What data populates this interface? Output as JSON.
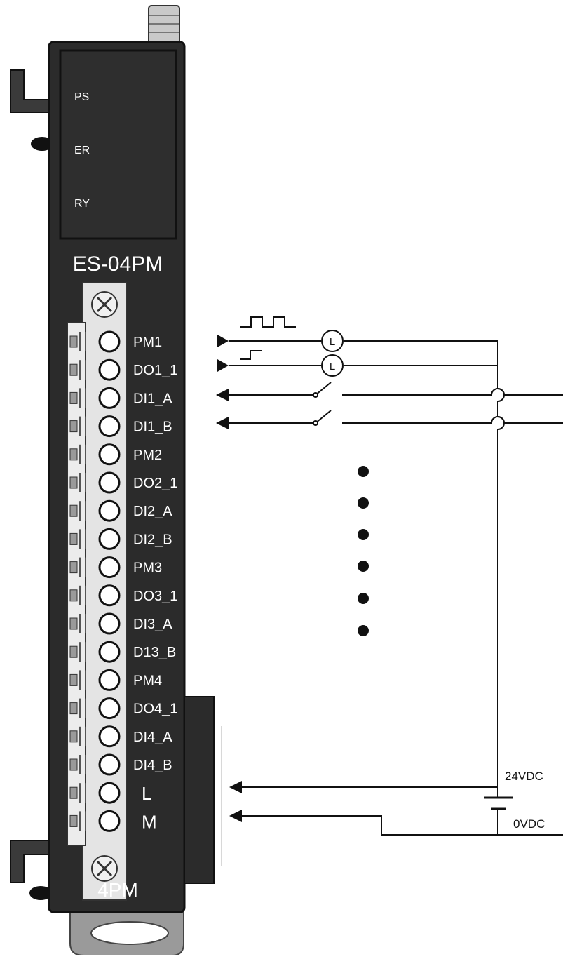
{
  "module": {
    "leds": [
      "PS",
      "ER",
      "RY"
    ],
    "model": "ES-04PM",
    "footer": "4PM",
    "terminals": [
      "PM1",
      "DO1_1",
      "DI1_A",
      "DI1_B",
      "PM2",
      "DO2_1",
      "DI2_A",
      "DI2_B",
      "PM3",
      "DO3_1",
      "DI3_A",
      "D13_B",
      "PM4",
      "DO4_1",
      "DI4_A",
      "DI4_B",
      "L",
      "M"
    ]
  },
  "circuit": {
    "lamp_symbol": "L",
    "supply_positive": "24VDC",
    "supply_zero": "0VDC"
  },
  "colors": {
    "housing": "#2b2b2b",
    "housing_dark": "#1c1c1c",
    "terminal_block": "#e4e4e4",
    "wire": "#111111"
  }
}
